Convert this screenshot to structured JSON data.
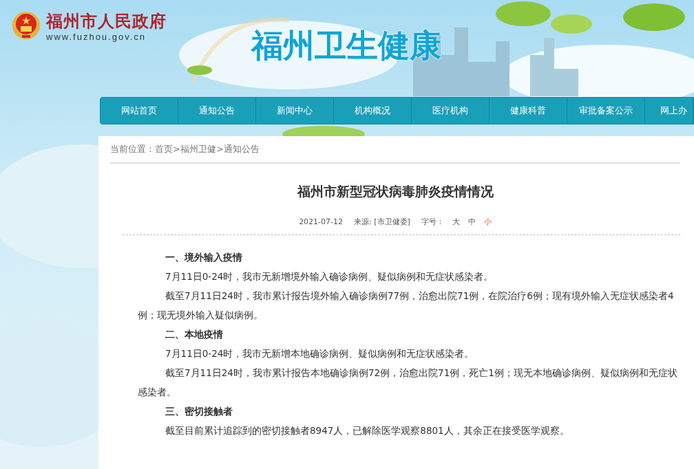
{
  "header": {
    "gov_name": "福州市人民政府",
    "gov_url": "www.fuzhou.gov.cn",
    "site_title": "福州卫生健康"
  },
  "nav": [
    {
      "label": "网站首页"
    },
    {
      "label": "通知公告"
    },
    {
      "label": "新闻中心"
    },
    {
      "label": "机构概况"
    },
    {
      "label": "医疗机构"
    },
    {
      "label": "健康科普"
    },
    {
      "label": "审批备案公示"
    },
    {
      "label": "网上办"
    }
  ],
  "breadcrumb": {
    "prefix": "当前位置：",
    "items": [
      "首页",
      "福州卫健",
      "通知公告"
    ],
    "separator": ">"
  },
  "article": {
    "title": "福州市新型冠状病毒肺炎疫情情况",
    "date": "2021-07-12",
    "source": "来源: [市卫健委]",
    "font_size_label": "字号：",
    "font_sizes": [
      {
        "label": "大",
        "selected": false
      },
      {
        "label": "中",
        "selected": false
      },
      {
        "label": "小",
        "selected": true
      }
    ],
    "paragraphs": [
      {
        "kind": "heading",
        "text": "一、境外输入疫情"
      },
      {
        "kind": "body",
        "text": "7月11日0-24时，我市无新增境外输入确诊病例、疑似病例和无症状感染者。"
      },
      {
        "kind": "body",
        "text": "截至7月11日24时，我市累计报告境外输入确诊病例77例，治愈出院71例，在院治疗6例；现有境外输入无症状感染者4例；现无境外输入疑似病例。"
      },
      {
        "kind": "heading",
        "text": "二、本地疫情"
      },
      {
        "kind": "body",
        "text": "7月11日0-24时，我市无新增本地确诊病例、疑似病例和无症状感染者。"
      },
      {
        "kind": "body",
        "text": "截至7月11日24时，我市累计报告本地确诊病例72例，治愈出院71例，死亡1例；现无本地确诊病例、疑似病例和无症状感染者。"
      },
      {
        "kind": "heading",
        "text": "三、密切接触者"
      },
      {
        "kind": "body",
        "text": "截至目前累计追踪到的密切接触者8947人，已解除医学观察8801人，其余正在接受医学观察。"
      }
    ]
  }
}
